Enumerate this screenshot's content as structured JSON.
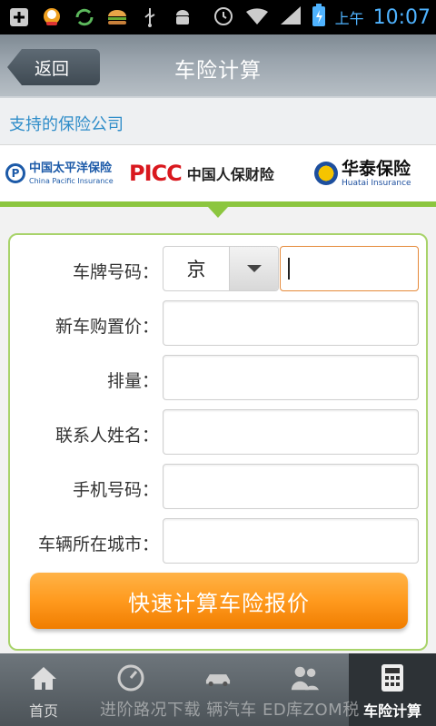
{
  "status_bar": {
    "ampm": "上午",
    "time": "10:07",
    "icons": [
      "add-box-icon",
      "chat-bubble-icon",
      "sync-icon",
      "burger-icon",
      "usb-icon",
      "android-icon",
      "alarm-icon",
      "wifi-icon",
      "signal-icon",
      "battery-charging-icon"
    ]
  },
  "header": {
    "back_label": "返回",
    "title": "车险计算"
  },
  "section": {
    "title": "支持的保险公司"
  },
  "insurers": {
    "cpic_cn": "中国太平洋保险",
    "cpic_en": "China Pacific Insurance",
    "picc_en": "PICC",
    "picc_cn": "中国人保财险",
    "huatai_cn": "华泰保险",
    "huatai_en": "Huatai Insurance"
  },
  "form": {
    "plate_label": "车牌号码：",
    "plate_prefix": "京",
    "plate_value": "",
    "price_label": "新车购置价：",
    "displacement_label": "排量：",
    "contact_label": "联系人姓名：",
    "phone_label": "手机号码：",
    "city_label": "车辆所在城市：",
    "submit_label": "快速计算车险报价"
  },
  "nav": {
    "items": [
      {
        "label": "首页",
        "icon": "home-icon"
      },
      {
        "label": "",
        "icon": "speedometer-icon"
      },
      {
        "label": "",
        "icon": "car-icon"
      },
      {
        "label": "",
        "icon": "people-icon"
      },
      {
        "label": "车险计算",
        "icon": "calculator-icon",
        "active": true
      }
    ],
    "watermark": "进阶路况下载 辆汽车 ED库ZOM税"
  }
}
